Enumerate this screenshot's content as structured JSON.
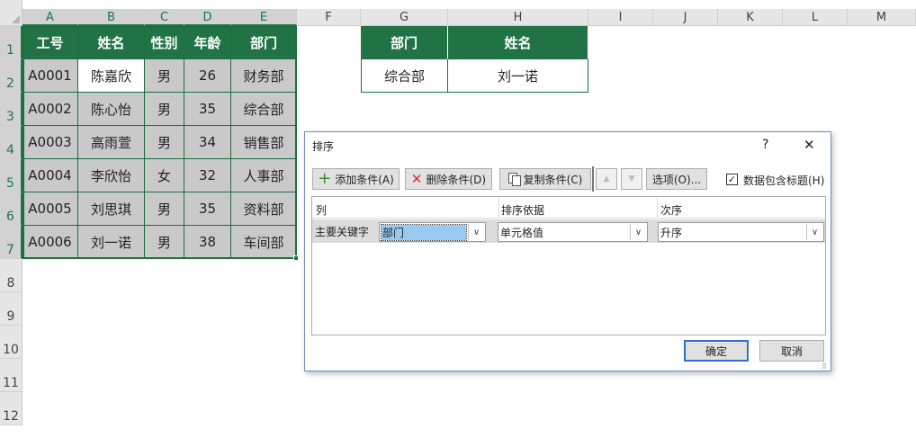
{
  "sheet": {
    "columns": [
      "A",
      "B",
      "C",
      "D",
      "E",
      "F",
      "G",
      "H",
      "I",
      "J",
      "K",
      "L",
      "M"
    ],
    "rows": [
      "1",
      "2",
      "3",
      "4",
      "5",
      "6",
      "7",
      "8",
      "9",
      "10",
      "11",
      "12"
    ],
    "table": {
      "headers": [
        "工号",
        "姓名",
        "性别",
        "年龄",
        "部门"
      ],
      "rows": [
        [
          "A0001",
          "陈嘉欣",
          "男",
          "26",
          "财务部"
        ],
        [
          "A0002",
          "陈心怡",
          "男",
          "35",
          "综合部"
        ],
        [
          "A0003",
          "高雨萱",
          "男",
          "34",
          "销售部"
        ],
        [
          "A0004",
          "李欣怡",
          "女",
          "32",
          "人事部"
        ],
        [
          "A0005",
          "刘思琪",
          "男",
          "35",
          "资料部"
        ],
        [
          "A0006",
          "刘一诺",
          "男",
          "38",
          "车间部"
        ]
      ]
    },
    "lookup": {
      "headers": [
        "部门",
        "姓名"
      ],
      "values": [
        "综合部",
        "刘一诺"
      ]
    },
    "colors": {
      "header_green": "#217346",
      "selection_gray": "#c9c9c9"
    }
  },
  "dialog": {
    "title": "排序",
    "help": "?",
    "close": "✕",
    "toolbar": {
      "add": "添加条件(A)",
      "delete": "删除条件(D)",
      "copy": "复制条件(C)",
      "up": "▲",
      "down": "▼",
      "options": "选项(O)...",
      "has_header_label": "数据包含标题(H)",
      "has_header_checked": true
    },
    "grid": {
      "col_header": "列",
      "sort_on_header": "排序依据",
      "order_header": "次序",
      "row_label": "主要关键字",
      "column_value": "部门",
      "sort_on_value": "单元格值",
      "order_value": "升序"
    },
    "ok": "确定",
    "cancel": "取消"
  }
}
